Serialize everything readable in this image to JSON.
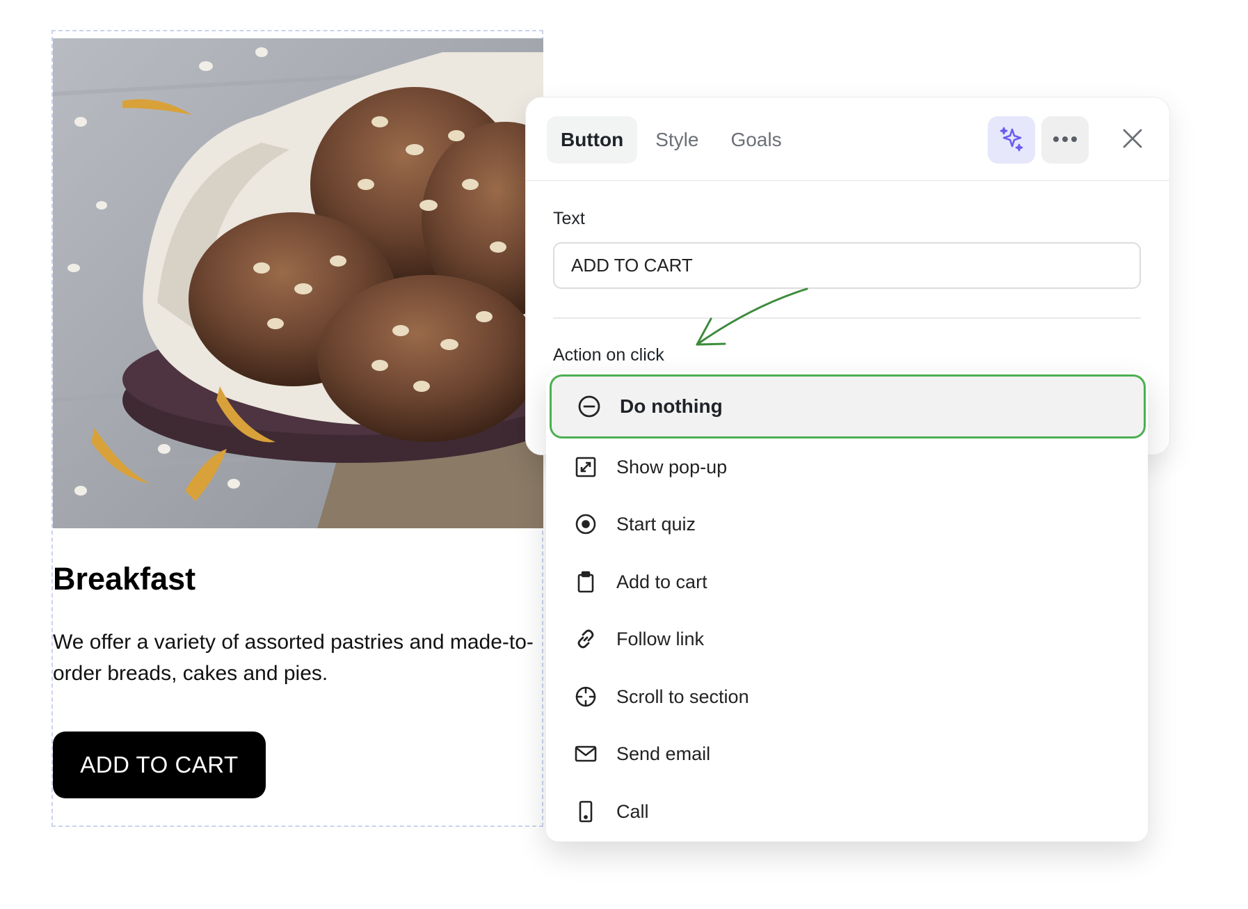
{
  "card": {
    "title": "Breakfast",
    "description": "We offer a variety of assorted pastries and made-to-order breads, cakes and pies.",
    "button_label": "ADD TO CART"
  },
  "panel": {
    "tabs": [
      {
        "label": "Button",
        "active": true
      },
      {
        "label": "Style",
        "active": false
      },
      {
        "label": "Goals",
        "active": false
      }
    ],
    "ai_icon": "sparkle-icon",
    "more_icon": "more-horizontal-icon",
    "close_icon": "close-icon",
    "text_label": "Text",
    "text_value": "ADD TO CART",
    "action_label": "Action on click"
  },
  "actions": {
    "selected": {
      "label": "Do nothing",
      "icon": "minus-circle-icon"
    },
    "items": [
      {
        "label": "Show pop-up",
        "icon": "popup-icon"
      },
      {
        "label": "Start quiz",
        "icon": "target-icon"
      },
      {
        "label": "Add to cart",
        "icon": "clipboard-icon"
      },
      {
        "label": "Follow link",
        "icon": "link-icon"
      },
      {
        "label": "Scroll to section",
        "icon": "crosshair-icon"
      },
      {
        "label": "Send email",
        "icon": "mail-icon"
      },
      {
        "label": "Call",
        "icon": "phone-icon"
      }
    ]
  },
  "colors": {
    "selected_border": "#4caf50",
    "annotation_arrow": "#3d8b3d",
    "ai_accent": "#6b5cf0",
    "cta_background": "#000000"
  }
}
